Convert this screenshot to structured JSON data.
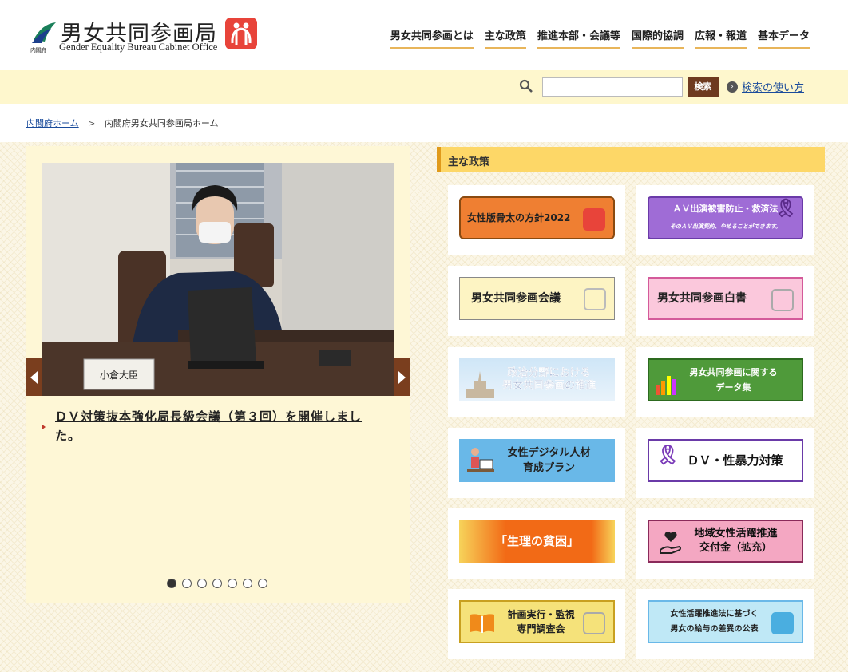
{
  "header": {
    "logo_label": "内閣府",
    "title": "男女共同参画局",
    "subtitle": "Gender Equality Bureau Cabinet Office",
    "nav": [
      "男女共同参画とは",
      "主な政策",
      "推進本部・会議等",
      "国際的協調",
      "広報・報道",
      "基本データ"
    ]
  },
  "search": {
    "value": "",
    "button": "検索",
    "help_link": "検索の使い方"
  },
  "breadcrumb": {
    "home": "内閣府ホーム",
    "separator": ">",
    "current": "内閣府男女共同参画局ホーム"
  },
  "slider": {
    "photo_nameplate": "小倉大臣",
    "caption": "ＤＶ対策抜本強化局長級会議（第３回）を開催しました。",
    "dot_count": 7,
    "active_dot": 1
  },
  "policy": {
    "heading": "主な政策",
    "tiles": [
      {
        "text": "女性版骨太の方針2022",
        "sub": ""
      },
      {
        "text": "ＡＶ出演被害防止・救済法",
        "sub": "そのＡＶ出演契約、やめることができます。"
      },
      {
        "text": "男女共同参画会議",
        "sub": ""
      },
      {
        "text": "男女共同参画白書",
        "sub": ""
      },
      {
        "text": "政治分野における",
        "sub": "男女共同参画の推進"
      },
      {
        "text": "男女共同参画に関する",
        "sub": "データ集"
      },
      {
        "text": "女性デジタル人材",
        "sub": "育成プラン"
      },
      {
        "text": "ＤＶ・性暴力対策",
        "sub": ""
      },
      {
        "text": "「生理の貧困」",
        "sub": ""
      },
      {
        "text": "地域女性活躍推進",
        "sub": "交付金（拡充）"
      },
      {
        "text": "計画実行・監視",
        "sub": "専門調査会"
      },
      {
        "text": "女性活躍推進法に基づく",
        "sub": "男女の給与の差異の公表"
      }
    ]
  },
  "colors": {
    "brand_red": "#e8443a",
    "nav_underline": "#e8b55a",
    "search_band": "#fef7cd",
    "button_brown": "#6e3a1f",
    "heading_yellow": "#fdd767"
  }
}
